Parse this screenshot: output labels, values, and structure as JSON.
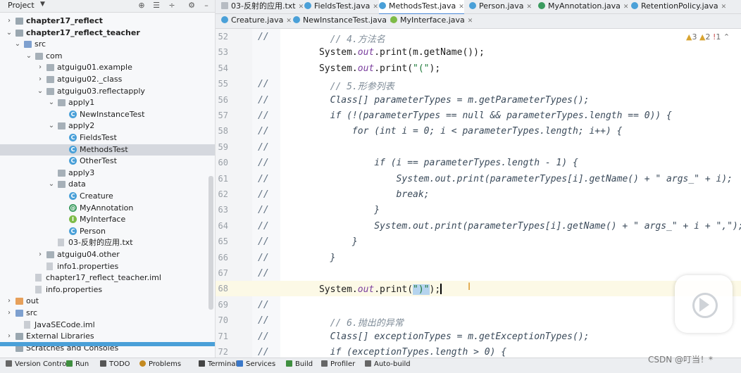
{
  "project_panel": {
    "title": "Project",
    "tree": [
      {
        "label": "chapter17_reflect",
        "bold": true,
        "chev": "›",
        "icon": "folder"
      },
      {
        "label": "chapter17_reflect_teacher",
        "bold": true,
        "chev": "⌄",
        "icon": "folder"
      },
      {
        "label": "src",
        "chev": "⌄",
        "icon": "folder-blue"
      },
      {
        "label": "com",
        "chev": "⌄",
        "icon": "package"
      },
      {
        "label": "atguigu01.example",
        "chev": "›",
        "icon": "package"
      },
      {
        "label": "atguigu02._class",
        "chev": "›",
        "icon": "package"
      },
      {
        "label": "atguigu03.reflectapply",
        "chev": "⌄",
        "icon": "package"
      },
      {
        "label": "apply1",
        "chev": "⌄",
        "icon": "package"
      },
      {
        "label": "NewInstanceTest",
        "chev": "",
        "icon": "class"
      },
      {
        "label": "apply2",
        "chev": "⌄",
        "icon": "package"
      },
      {
        "label": "FieldsTest",
        "chev": "",
        "icon": "class"
      },
      {
        "label": "MethodsTest",
        "chev": "",
        "icon": "class",
        "selected": true
      },
      {
        "label": "OtherTest",
        "chev": "",
        "icon": "class"
      },
      {
        "label": "apply3",
        "chev": "",
        "icon": "package"
      },
      {
        "label": "data",
        "chev": "⌄",
        "icon": "package"
      },
      {
        "label": "Creature",
        "chev": "",
        "icon": "class"
      },
      {
        "label": "MyAnnotation",
        "chev": "",
        "icon": "annotation"
      },
      {
        "label": "MyInterface",
        "chev": "",
        "icon": "interface"
      },
      {
        "label": "Person",
        "chev": "",
        "icon": "class"
      },
      {
        "label": "03-反射的应用.txt",
        "chev": "",
        "icon": "file"
      },
      {
        "label": "atguigu04.other",
        "chev": "›",
        "icon": "package"
      },
      {
        "label": "info1.properties",
        "chev": "",
        "icon": "file"
      },
      {
        "label": "chapter17_reflect_teacher.iml",
        "chev": "",
        "icon": "file"
      },
      {
        "label": "info.properties",
        "chev": "",
        "icon": "file"
      },
      {
        "label": "out",
        "chev": "›",
        "icon": "folder-orange"
      },
      {
        "label": "src",
        "chev": "›",
        "icon": "folder-blue"
      },
      {
        "label": "JavaSECode.iml",
        "chev": "",
        "icon": "file"
      },
      {
        "label": "External Libraries",
        "chev": "›",
        "icon": "folder"
      },
      {
        "label": "Scratches and Consoles",
        "chev": "",
        "icon": "folder"
      }
    ]
  },
  "tabs_row1": [
    {
      "label": "03-反射的应用.txt",
      "icon": "txt"
    },
    {
      "label": "FieldsTest.java",
      "icon": "class"
    },
    {
      "label": "MethodsTest.java",
      "icon": "class",
      "active": true
    },
    {
      "label": "Person.java",
      "icon": "class"
    },
    {
      "label": "MyAnnotation.java",
      "icon": "annotation"
    },
    {
      "label": "RetentionPolicy.java",
      "icon": "class"
    }
  ],
  "tabs_row2": [
    {
      "label": "Creature.java",
      "icon": "class"
    },
    {
      "label": "NewInstanceTest.java",
      "icon": "class"
    },
    {
      "label": "MyInterface.java",
      "icon": "interface"
    }
  ],
  "inspections": {
    "warnings": "3",
    "weak_warnings": "2",
    "errors": "1"
  },
  "editor": {
    "lines": [
      {
        "num": "52",
        "cm": "//",
        "html": "        <span class=\"comment\">// 4.方法名</span>"
      },
      {
        "num": "53",
        "cm": "",
        "html": "      System.<span class=\"fld\">out</span>.print(m.getName());"
      },
      {
        "num": "54",
        "cm": "",
        "html": "      System.<span class=\"fld\">out</span>.print(<span class=\"str\">\"(\"</span>);"
      },
      {
        "num": "55",
        "cm": "//",
        "html": "        <span class=\"comment\">// 5.形参列表</span>"
      },
      {
        "num": "56",
        "cm": "//",
        "html": "        <span class=\"italic\">Class[] parameterTypes = m.getParameterTypes();</span>"
      },
      {
        "num": "57",
        "cm": "//",
        "html": "        <span class=\"italic\">if (!(parameterTypes == null &amp;&amp; parameterTypes.length == 0)) {</span>"
      },
      {
        "num": "58",
        "cm": "//",
        "html": "            <span class=\"italic\">for (int i = 0; i &lt; parameterTypes.length; i++) {</span>"
      },
      {
        "num": "59",
        "cm": "//",
        "html": ""
      },
      {
        "num": "60",
        "cm": "//",
        "html": "                <span class=\"italic\">if (i == parameterTypes.length - 1) {</span>"
      },
      {
        "num": "61",
        "cm": "//",
        "html": "                    <span class=\"italic\">System.out.print(parameterTypes[i].getName() + \" args_\" + i);</span>"
      },
      {
        "num": "62",
        "cm": "//",
        "html": "                    <span class=\"italic\">break;</span>"
      },
      {
        "num": "63",
        "cm": "//",
        "html": "                <span class=\"italic\">}</span>"
      },
      {
        "num": "64",
        "cm": "//",
        "html": "                <span class=\"italic\">System.out.print(parameterTypes[i].getName() + \" args_\" + i + \",\");</span>"
      },
      {
        "num": "65",
        "cm": "//",
        "html": "            <span class=\"italic\">}</span>"
      },
      {
        "num": "66",
        "cm": "//",
        "html": "        <span class=\"italic\">}</span>"
      },
      {
        "num": "67",
        "cm": "//",
        "html": ""
      },
      {
        "num": "68",
        "cm": "",
        "html": "      System.<span class=\"fld\">out</span>.print(<span class=\"sel-str\"><span class=\"str\">\")\"</span></span>);<span class=\"caret\"></span>",
        "current": true
      },
      {
        "num": "69",
        "cm": "//",
        "html": ""
      },
      {
        "num": "70",
        "cm": "//",
        "html": "        <span class=\"comment\">// 6.抛出的异常</span>"
      },
      {
        "num": "71",
        "cm": "//",
        "html": "        <span class=\"italic\">Class[] exceptionTypes = m.getExceptionTypes();</span>"
      },
      {
        "num": "72",
        "cm": "//",
        "html": "        <span class=\"italic\">if (exceptionTypes.length &gt; 0) {</span>"
      }
    ]
  },
  "status_bar": [
    {
      "label": "Version Control",
      "icon": "vcs-icon"
    },
    {
      "label": "Run",
      "icon": "run-icon"
    },
    {
      "label": "TODO",
      "icon": "todo-icon"
    },
    {
      "label": "Problems",
      "icon": "problems-icon"
    },
    {
      "label": "Terminal",
      "icon": "terminal-icon"
    },
    {
      "label": "Services",
      "icon": "services-icon"
    },
    {
      "label": "Build",
      "icon": "build-icon"
    },
    {
      "label": "Profiler",
      "icon": "profiler-icon"
    },
    {
      "label": "Auto-build",
      "icon": "autobuild-icon"
    }
  ],
  "watermark": "CSDN @叮当！*"
}
